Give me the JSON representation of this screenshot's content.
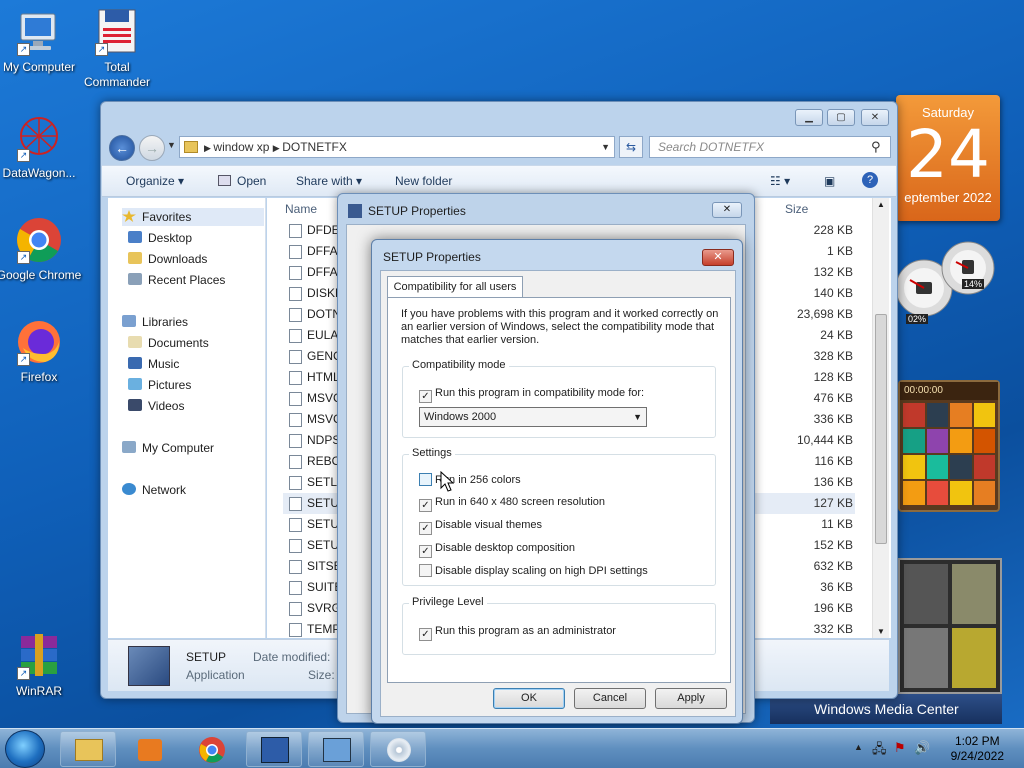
{
  "desktop": {
    "icons": [
      {
        "label": "My Computer",
        "icon": "computer-icon"
      },
      {
        "label": "Total Commander",
        "icon": "floppy-icon"
      },
      {
        "label": "DataWagon...",
        "icon": "network-ball-icon"
      },
      {
        "label": "Google Chrome",
        "icon": "chrome-icon"
      },
      {
        "label": "Firefox",
        "icon": "firefox-icon"
      },
      {
        "label": "WinRAR",
        "icon": "winrar-icon"
      }
    ]
  },
  "gadgets": {
    "calendar": {
      "weekday": "Saturday",
      "day": "24",
      "month": "eptember 2022"
    },
    "meter": {
      "cpu": "02%",
      "ram": "14%"
    },
    "puzzle": {
      "timer": "00:00:00"
    },
    "media_center": {
      "label": "Windows Media Center"
    }
  },
  "explorer": {
    "address": {
      "path": [
        "window xp",
        "DOTNETFX"
      ]
    },
    "search": {
      "placeholder": "Search DOTNETFX"
    },
    "toolbar": {
      "organize": "Organize",
      "open": "Open",
      "share": "Share with",
      "new_folder": "New folder"
    },
    "nav": {
      "favorites": "Favorites",
      "desktop": "Desktop",
      "downloads": "Downloads",
      "recent": "Recent Places",
      "libraries": "Libraries",
      "documents": "Documents",
      "music": "Music",
      "pictures": "Pictures",
      "videos": "Videos",
      "computer": "My Computer",
      "network": "Network"
    },
    "columns": {
      "name": "Name",
      "size": "Size"
    },
    "files": [
      {
        "name": "DFDEF",
        "size": "228 KB"
      },
      {
        "name": "DFFAC",
        "size": "1 KB"
      },
      {
        "name": "DFFAC",
        "size": "132 KB"
      },
      {
        "name": "DISKM",
        "size": "140 KB"
      },
      {
        "name": "DOTN",
        "size": "23,698 KB"
      },
      {
        "name": "EULA",
        "size": "24 KB"
      },
      {
        "name": "GENC",
        "size": "328 KB"
      },
      {
        "name": "HTML",
        "size": "128 KB"
      },
      {
        "name": "MSVC",
        "size": "476 KB"
      },
      {
        "name": "MSVC",
        "size": "336 KB"
      },
      {
        "name": "NDPS",
        "size": "10,444 KB"
      },
      {
        "name": "REBO",
        "size": "116 KB"
      },
      {
        "name": "SETLO",
        "size": "136 KB"
      },
      {
        "name": "SETUP",
        "size": "127 KB"
      },
      {
        "name": "SETUP",
        "size": "11 KB"
      },
      {
        "name": "SETUP",
        "size": "152 KB"
      },
      {
        "name": "SITSE",
        "size": "632 KB"
      },
      {
        "name": "SUITE",
        "size": "36 KB"
      },
      {
        "name": "SVRGF",
        "size": "196 KB"
      },
      {
        "name": "TEMP",
        "size": "332 KB"
      }
    ],
    "details": {
      "name": "SETUP",
      "type": "Application",
      "modified_label": "Date modified:",
      "size_label": "Size:"
    }
  },
  "back_dialog": {
    "title": "SETUP Properties"
  },
  "dialog": {
    "title": "SETUP Properties",
    "tab": "Compatibility for all users",
    "intro": "If you have problems with this program and it worked correctly on an earlier version of Windows, select the compatibility mode that matches that earlier version.",
    "compat": {
      "group_title": "Compatibility mode",
      "checkbox_label": "Run this program in compatibility mode for:",
      "checked": true,
      "selected_os": "Windows 2000"
    },
    "settings": {
      "group_title": "Settings",
      "items": [
        {
          "label": "Run in 256 colors",
          "checked": false
        },
        {
          "label": "Run in 640 x 480 screen resolution",
          "checked": true
        },
        {
          "label": "Disable visual themes",
          "checked": true
        },
        {
          "label": "Disable desktop composition",
          "checked": true
        },
        {
          "label": "Disable display scaling on high DPI settings",
          "checked": false
        }
      ]
    },
    "privilege": {
      "group_title": "Privilege Level",
      "checkbox_label": "Run this program as an administrator",
      "checked": true
    },
    "buttons": {
      "ok": "OK",
      "cancel": "Cancel",
      "apply": "Apply"
    }
  },
  "taskbar": {
    "time": "1:02 PM",
    "date": "9/24/2022"
  },
  "colors": {
    "desktop": "#0f5fb8",
    "dialog_frame": "#c4d8ee",
    "accent": "#3c7fb1"
  }
}
